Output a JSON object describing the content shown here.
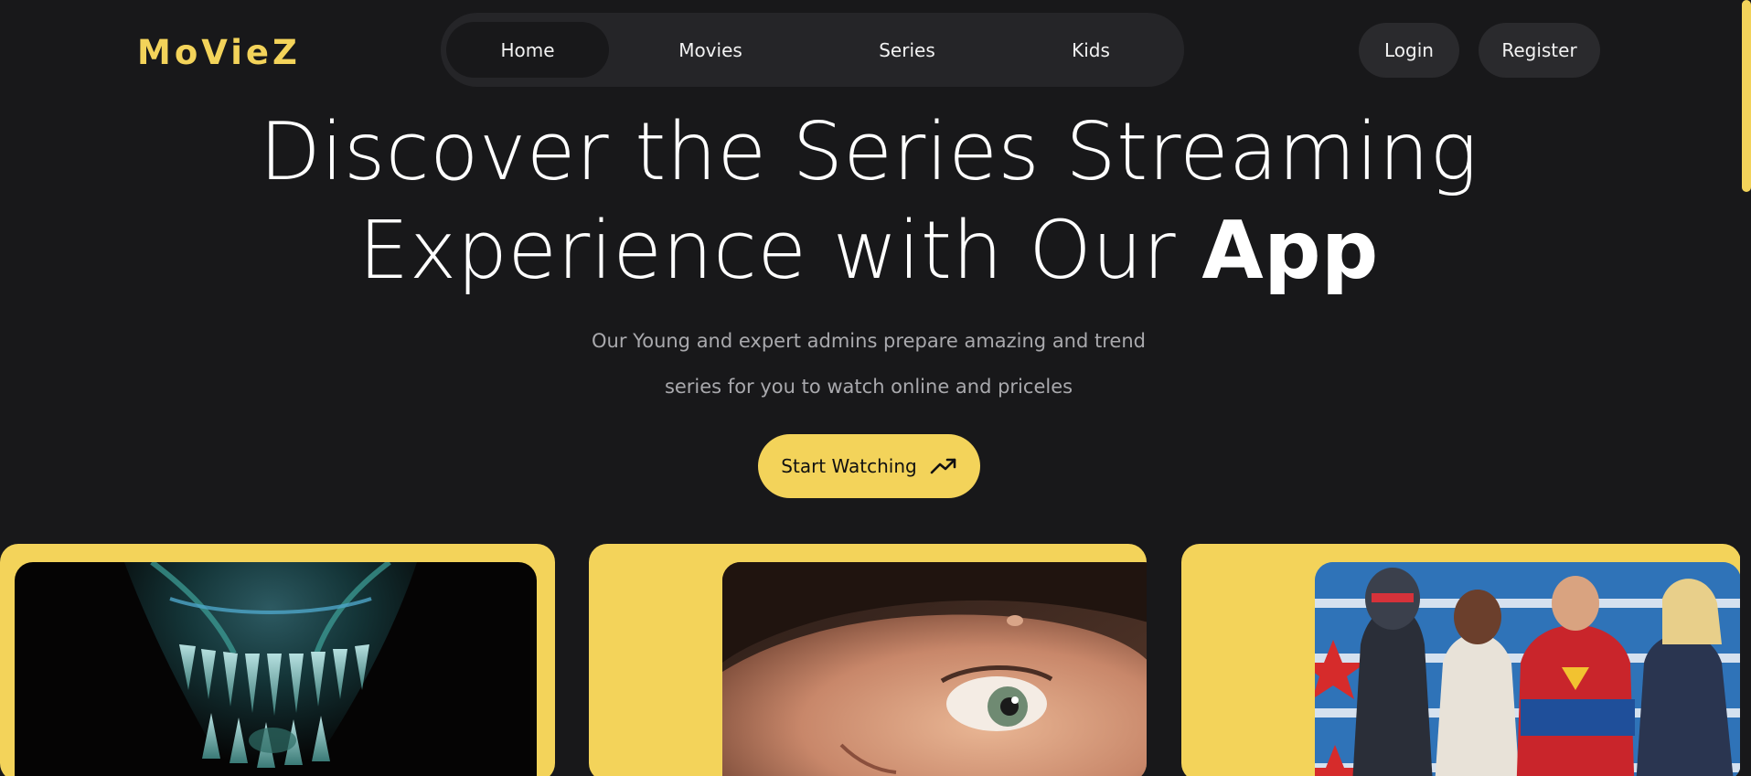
{
  "brand": {
    "logo": "MoVieZ",
    "accent_color": "#f3d35a"
  },
  "nav": {
    "items": [
      {
        "label": "Home",
        "active": true
      },
      {
        "label": "Movies",
        "active": false
      },
      {
        "label": "Series",
        "active": false
      },
      {
        "label": "Kids",
        "active": false
      }
    ]
  },
  "auth": {
    "login_label": "Login",
    "register_label": "Register"
  },
  "hero": {
    "title_line1": "Discover the Series Streaming",
    "title_line2_prefix": "Experience with Our ",
    "title_line2_bold": "App",
    "subtitle_line1": "Our Young and expert admins prepare amazing and trend",
    "subtitle_line2": "series for you to watch online and priceles",
    "cta_label": "Start Watching",
    "cta_icon": "trending-up-icon"
  },
  "cards": [
    {
      "name": "alien-poster"
    },
    {
      "name": "woman-face-poster"
    },
    {
      "name": "superhero-team-poster"
    }
  ]
}
